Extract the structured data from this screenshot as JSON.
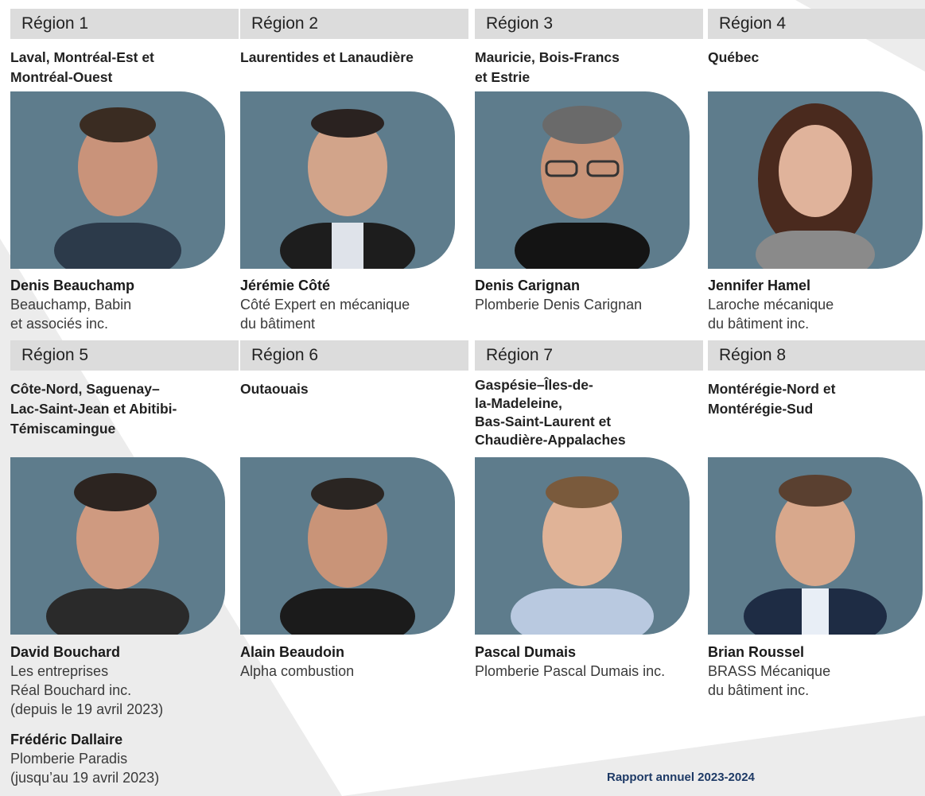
{
  "colors": {
    "header_bg": "#dcdcdc",
    "photo_bg": "#5e7c8c",
    "footer_text": "#1e3a66"
  },
  "regions": [
    {
      "label": "Région 1",
      "areas": "Laval, Montréal-Est et\nMontréal-Ouest",
      "people": [
        {
          "name": "Denis Beauchamp",
          "company": "Beauchamp, Babin\net associés inc."
        }
      ]
    },
    {
      "label": "Région 2",
      "areas": "Laurentides et Lanaudière",
      "people": [
        {
          "name": "Jérémie Côté",
          "company": "Côté Expert en mécanique\ndu bâtiment"
        }
      ]
    },
    {
      "label": "Région 3",
      "areas": "Mauricie, Bois-Francs\net Estrie",
      "people": [
        {
          "name": "Denis Carignan",
          "company": "Plomberie Denis Carignan"
        }
      ]
    },
    {
      "label": "Région 4",
      "areas": "Québec",
      "people": [
        {
          "name": "Jennifer Hamel",
          "company": "Laroche mécanique\ndu bâtiment inc."
        }
      ]
    },
    {
      "label": "Région 5",
      "areas": "Côte-Nord, Saguenay–\nLac-Saint-Jean et Abitibi-\nTémiscamingue",
      "people": [
        {
          "name": "David Bouchard",
          "company": "Les entreprises\nRéal Bouchard inc.\n(depuis le 19 avril 2023)"
        },
        {
          "name": "Frédéric Dallaire",
          "company": "Plomberie Paradis\n(jusqu’au 19 avril 2023)"
        }
      ]
    },
    {
      "label": "Région 6",
      "areas": "Outaouais",
      "people": [
        {
          "name": "Alain Beaudoin",
          "company": "Alpha combustion"
        }
      ]
    },
    {
      "label": "Région 7",
      "areas": "Gaspésie–Îles-de-\nla-Madeleine,\nBas-Saint-Laurent et\nChaudière-Appalaches",
      "people": [
        {
          "name": "Pascal Dumais",
          "company": "Plomberie Pascal Dumais inc."
        }
      ]
    },
    {
      "label": "Région 8",
      "areas": "Montérégie-Nord et\nMontérégie-Sud",
      "people": [
        {
          "name": "Brian Roussel",
          "company": "BRASS Mécanique\ndu bâtiment inc."
        }
      ]
    }
  ],
  "footer": {
    "text": "Rapport annuel 2023-2024"
  }
}
